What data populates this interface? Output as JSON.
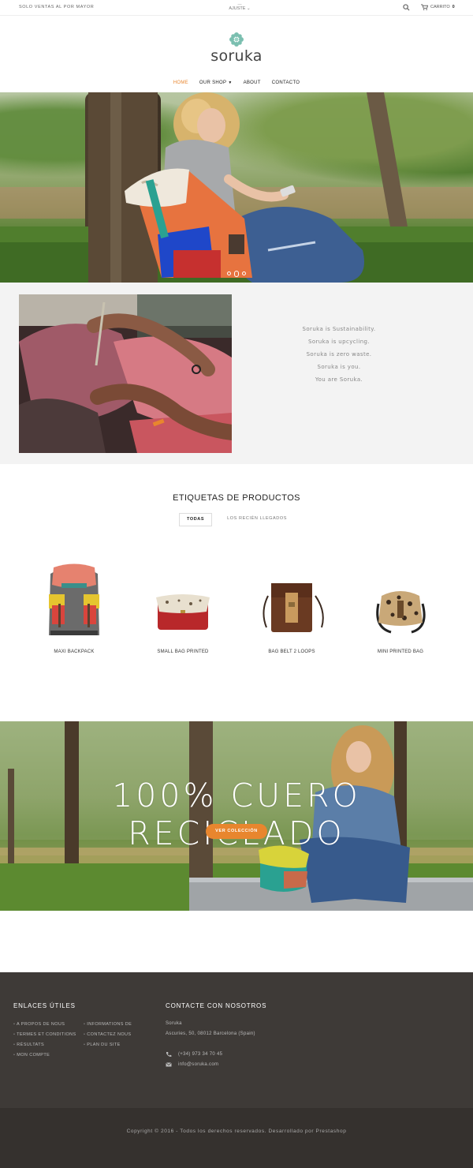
{
  "topbar": {
    "promo": "SOLO VENTAS AL POR MAYOR",
    "adjust_dash": "—",
    "adjust": "AJUSTE ⌄",
    "cart_label": "CARRITO",
    "cart_count": "0"
  },
  "brand": {
    "name": "soruka"
  },
  "nav": {
    "items": [
      {
        "label": "HOME"
      },
      {
        "label": "OUR SHOP"
      },
      {
        "label": "ABOUT"
      },
      {
        "label": "CONTACTO"
      }
    ]
  },
  "intro": {
    "lines": [
      "Soruka is Sustainability.",
      "Soruka is upcycling.",
      "Soruka is zero waste.",
      "Soruka is you.",
      "You are Soruka."
    ]
  },
  "products": {
    "title": "ETIQUETAS DE PRODUCTOS",
    "tabs": [
      {
        "label": "TODAS"
      },
      {
        "label": "LOS RECIÉN LLEGADOS"
      }
    ],
    "items": [
      {
        "name": "MAXI BACKPACK"
      },
      {
        "name": "SMALL BAG PRINTED"
      },
      {
        "name": "BAG BELT 2 LOOPS"
      },
      {
        "name": "MINI PRINTED BAG"
      }
    ]
  },
  "promo_banner": {
    "headline": "100% CUERO RECICLADO",
    "cta": "VER COLECCIÓN"
  },
  "footer": {
    "links_title": "ENLACES ÚTILES",
    "links_col1": [
      "A PROPOS DE NOUS",
      "TERMES ET CONDITIONS",
      "RÉSULTATS",
      "MON COMPTE"
    ],
    "links_col2": [
      "INFORMATIONS DE",
      "CONTACTEZ NOUS",
      "PLAN DU SITE"
    ],
    "contact_title": "CONTACTE CON NOSOTROS",
    "company": "Soruka",
    "address": "Ascuries, 50, 08012 Barcelona (Spain)",
    "phone": "(+34) 973 34 70 45",
    "email": "info@soruka.com",
    "copyright": "Copyright © 2016 - Todos los derechos reservados. Desarrollado por Prestashop"
  },
  "colors": {
    "accent": "#e8862e",
    "footer_bg": "#3e3a37",
    "footer_bottom": "#35312e",
    "intro_bg": "#f3f3f3"
  }
}
